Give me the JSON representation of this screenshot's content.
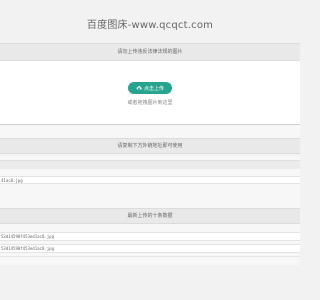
{
  "header": {
    "title": "百度图床-www.qcqct.com"
  },
  "upload_section": {
    "heading": "请勿上传违反法律法规的图片",
    "upload_button_label": "点击上传",
    "drop_hint": "或者拖拽图片到这里"
  },
  "copy_section": {
    "heading": "请复制下方外链地址即可使用",
    "link": "41ac8.jpg"
  },
  "recent_section": {
    "heading": "最新上传的十条数据",
    "items": [
      "53d14590f453ed1ac8.jpg",
      "53d14590f453ed1ac8.jpg"
    ]
  },
  "colors": {
    "accent": "#26a48f",
    "page_background": "#f2f2f2",
    "bar_background": "#e9e9e9"
  },
  "icons": {
    "upload_button": "cloud-upload-icon"
  }
}
